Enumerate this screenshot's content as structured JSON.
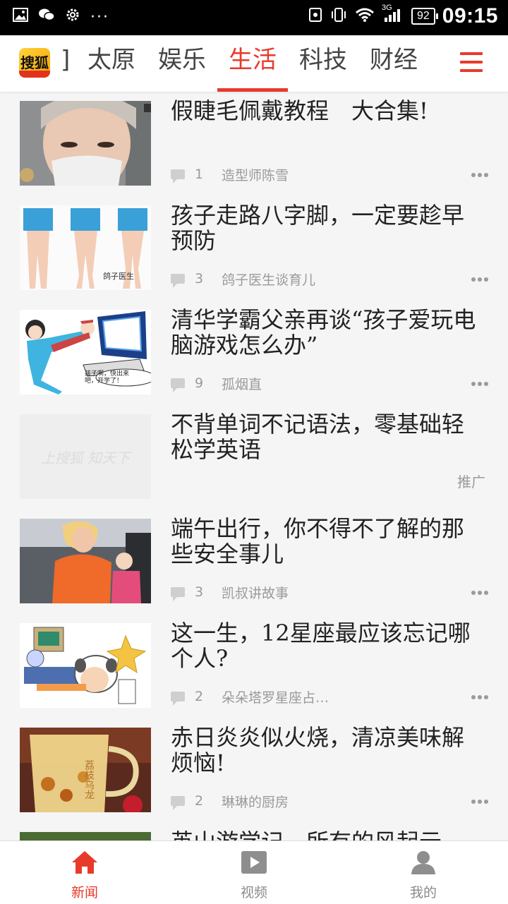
{
  "status_bar": {
    "time": "09:15",
    "battery": "92",
    "network": "3G"
  },
  "top_nav": {
    "logo_text": "搜狐",
    "tabs": [
      {
        "label": "]"
      },
      {
        "label": "太原"
      },
      {
        "label": "娱乐"
      },
      {
        "label": "生活"
      },
      {
        "label": "科技"
      },
      {
        "label": "财经"
      }
    ],
    "active_tab": "生活",
    "accent_color": "#e83a2b"
  },
  "feed": [
    {
      "title": "假睫毛佩戴教程　大合集!",
      "comments": "1",
      "source": "造型师陈雪"
    },
    {
      "title": "孩子走路八字脚，一定要趁早预防",
      "comments": "3",
      "source": "鸽子医生谈育儿",
      "thumb_caption": "鸽子医生"
    },
    {
      "title": "清华学霸父亲再谈“孩子爱玩电脑游戏怎么办”",
      "comments": "9",
      "source": "孤烟直",
      "thumb_caption": "孩子啊，快出来吧，开学了！"
    },
    {
      "title": "不背单词不记语法，零基础轻松学英语",
      "promo_label": "推广",
      "thumb_text": "上搜狐 知天下"
    },
    {
      "title": "端午出行，你不得不了解的那些安全事儿",
      "comments": "3",
      "source": "凯叔讲故事"
    },
    {
      "title": "这一生，12星座最应该忘记哪个人?",
      "comments": "2",
      "source": "朵朵塔罗星座占…"
    },
    {
      "title": "赤日炎炎似火烧，清凉美味解烦恼!",
      "comments": "2",
      "source": "琳琳的厨房",
      "thumb_caption": "荔枝乌龙"
    },
    {
      "title": "英山游学记，所有的风起云"
    }
  ],
  "bottom_nav": {
    "items": [
      {
        "label": "新闻",
        "icon": "home-icon"
      },
      {
        "label": "视频",
        "icon": "video-icon"
      },
      {
        "label": "我的",
        "icon": "user-icon"
      }
    ],
    "active": "新闻"
  }
}
